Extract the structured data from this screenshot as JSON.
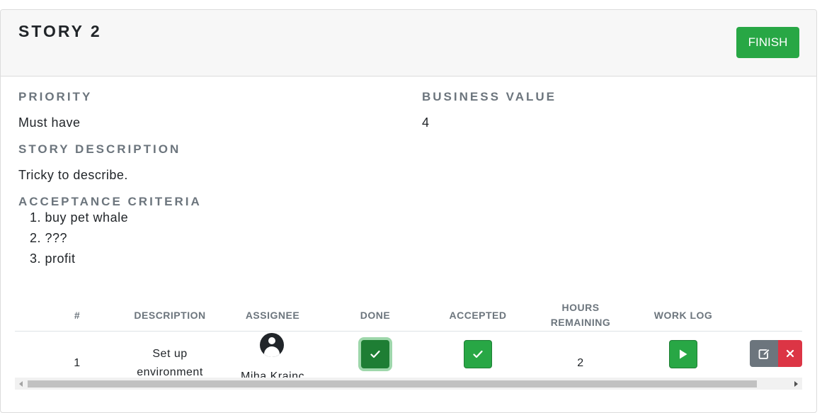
{
  "header": {
    "title": "STORY 2",
    "finish_label": "FINISH"
  },
  "details": {
    "priority_label": "PRIORITY",
    "priority_value": "Must have",
    "business_value_label": "BUSINESS VALUE",
    "business_value": "4",
    "description_label": "STORY DESCRIPTION",
    "description": "Tricky to describe.",
    "criteria_label": "ACCEPTANCE CRITERIA",
    "criteria": [
      "1. buy pet whale",
      "2. ???",
      "3. profit"
    ]
  },
  "table": {
    "headers": {
      "num": "#",
      "description": "DESCRIPTION",
      "assignee": "ASSIGNEE",
      "done": "DONE",
      "accepted": "ACCEPTED",
      "hours_line1": "HOURS",
      "hours_line2": "REMAINING",
      "work_log": "WORK LOG"
    },
    "rows": [
      {
        "num": "1",
        "description_line1": "Set up",
        "description_line2": "environment",
        "assignee": "Miha Krajnc",
        "hours_remaining": "2",
        "done_checked": true,
        "accepted_checked": true
      }
    ]
  },
  "icons": {
    "done": "check-icon",
    "accepted": "check-icon",
    "work_log": "play-icon",
    "edit": "edit-icon",
    "delete": "close-icon",
    "avatar": "user-icon"
  },
  "colors": {
    "success": "#28a745",
    "danger": "#dc3545",
    "secondary": "#6c757d",
    "header_bg": "#f7f7f7"
  }
}
